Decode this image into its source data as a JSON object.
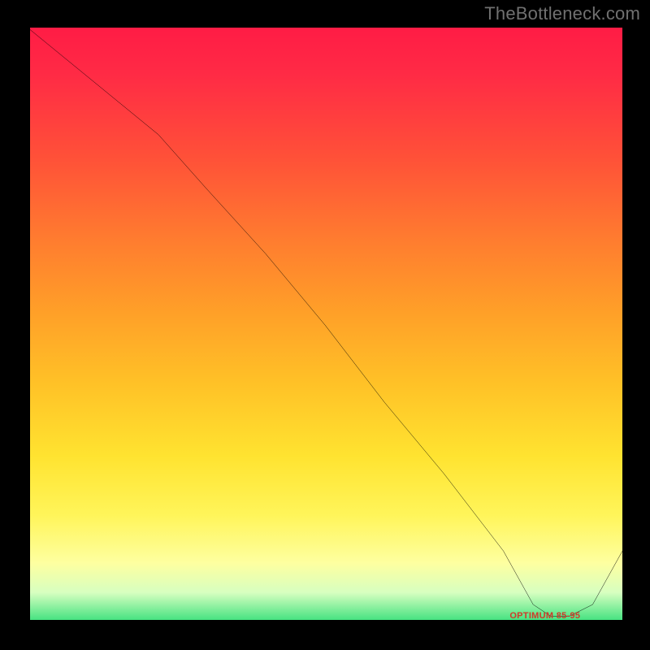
{
  "watermark": "TheBottleneck.com",
  "opt_label": "OPTIMUM 85-95",
  "colors": {
    "curve": "#000000",
    "frame": "#000000",
    "label": "#d03a2a"
  },
  "chart_data": {
    "type": "line",
    "title": "",
    "xlabel": "",
    "ylabel": "",
    "xlim": [
      0,
      100
    ],
    "ylim": [
      0,
      100
    ],
    "annotations": [
      {
        "text": "OPTIMUM 85-95",
        "x": 87,
        "y": 1
      }
    ],
    "series": [
      {
        "name": "bottleneck-curve",
        "x": [
          0,
          22,
          30,
          40,
          50,
          60,
          70,
          80,
          85,
          88,
          91,
          95,
          100
        ],
        "values": [
          100,
          82,
          73,
          62,
          50,
          37,
          25,
          12,
          3,
          1,
          1,
          3,
          12
        ]
      }
    ],
    "background_gradient": [
      {
        "stop": 0,
        "color": "#ff1c45"
      },
      {
        "stop": 22,
        "color": "#ff5138"
      },
      {
        "stop": 48,
        "color": "#ffa028"
      },
      {
        "stop": 72,
        "color": "#ffe330"
      },
      {
        "stop": 90,
        "color": "#feffa0"
      },
      {
        "stop": 100,
        "color": "#3ae07c"
      }
    ]
  }
}
